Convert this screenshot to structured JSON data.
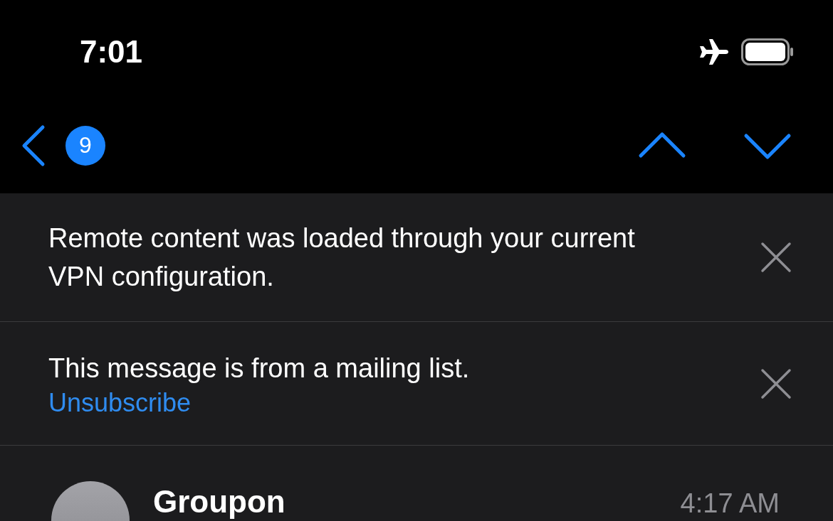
{
  "status_bar": {
    "time": "7:01"
  },
  "nav": {
    "badge": "9"
  },
  "banners": [
    {
      "text": "Remote content was loaded through your current VPN configuration."
    },
    {
      "text": "This message is from a mailing list.",
      "link": "Unsubscribe"
    }
  ],
  "message": {
    "sender": "Groupon",
    "time": "4:17 AM"
  }
}
